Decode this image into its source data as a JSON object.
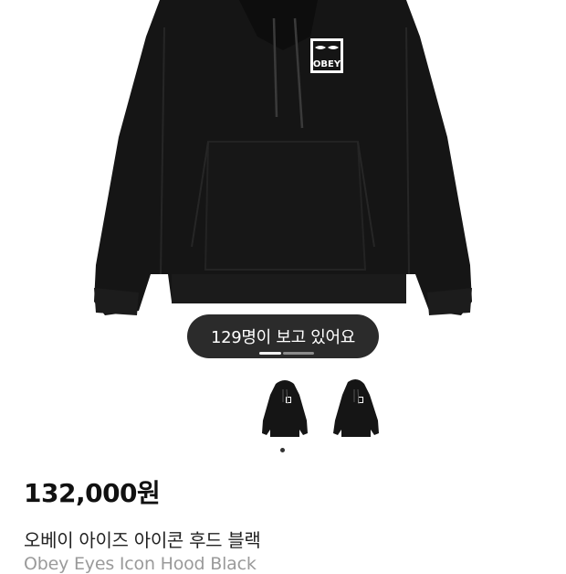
{
  "product": {
    "viewer_badge": "129명이 보고 있어요",
    "price": "132,000원",
    "name_ko": "오베이 아이즈 아이콘 후드 블랙",
    "name_en": "Obey Eyes Icon Hood Black",
    "logo_text": "OBEY"
  },
  "gallery": {
    "image_count": 2,
    "active_index": 0,
    "thumbnails": [
      {
        "icon": "hoodie-thumbnail-front"
      },
      {
        "icon": "hoodie-thumbnail-angle"
      }
    ]
  },
  "colors": {
    "hoodie": "#151515",
    "badge_bg": "#2b2b2b",
    "muted_text": "#9a9a9a"
  }
}
